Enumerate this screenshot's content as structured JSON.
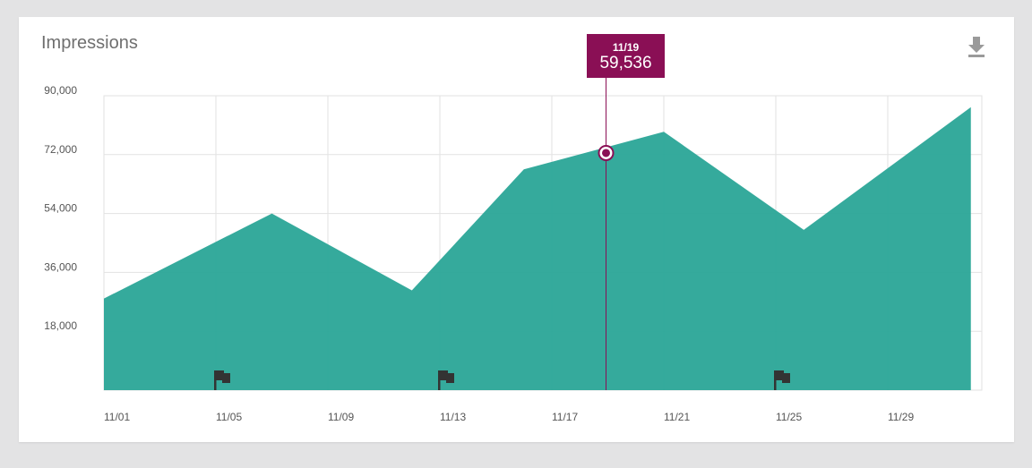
{
  "panel": {
    "title": "Impressions",
    "download_icon": "download-icon"
  },
  "tooltip": {
    "date": "11/19",
    "value": "59,536"
  },
  "chart_data": {
    "type": "area",
    "x_ticks": [
      "11/01",
      "11/05",
      "11/09",
      "11/13",
      "11/17",
      "11/21",
      "11/25",
      "11/29"
    ],
    "y_ticks": [
      "18,000",
      "36,000",
      "54,000",
      "72,000",
      "90,000"
    ],
    "ylim": [
      0,
      90000
    ],
    "series": [
      {
        "color": "#2aa597",
        "points": [
          {
            "x": "11/01",
            "y": 28000
          },
          {
            "x": "11/07",
            "y": 54000
          },
          {
            "x": "11/12",
            "y": 30500
          },
          {
            "x": "11/16",
            "y": 67500
          },
          {
            "x": "11/21",
            "y": 79000
          },
          {
            "x": "11/26",
            "y": 49000
          },
          {
            "x": "12/02",
            "y": 86500
          }
        ]
      }
    ],
    "highlight": {
      "x": "11/19",
      "y": 72500
    },
    "flag_markers": [
      "11/05",
      "11/13",
      "11/25"
    ],
    "grid": true,
    "colors": {
      "area": "#2aa597",
      "highlight": "#8a0f55",
      "flag": "#333333",
      "grid": "#e2e2e2"
    }
  }
}
